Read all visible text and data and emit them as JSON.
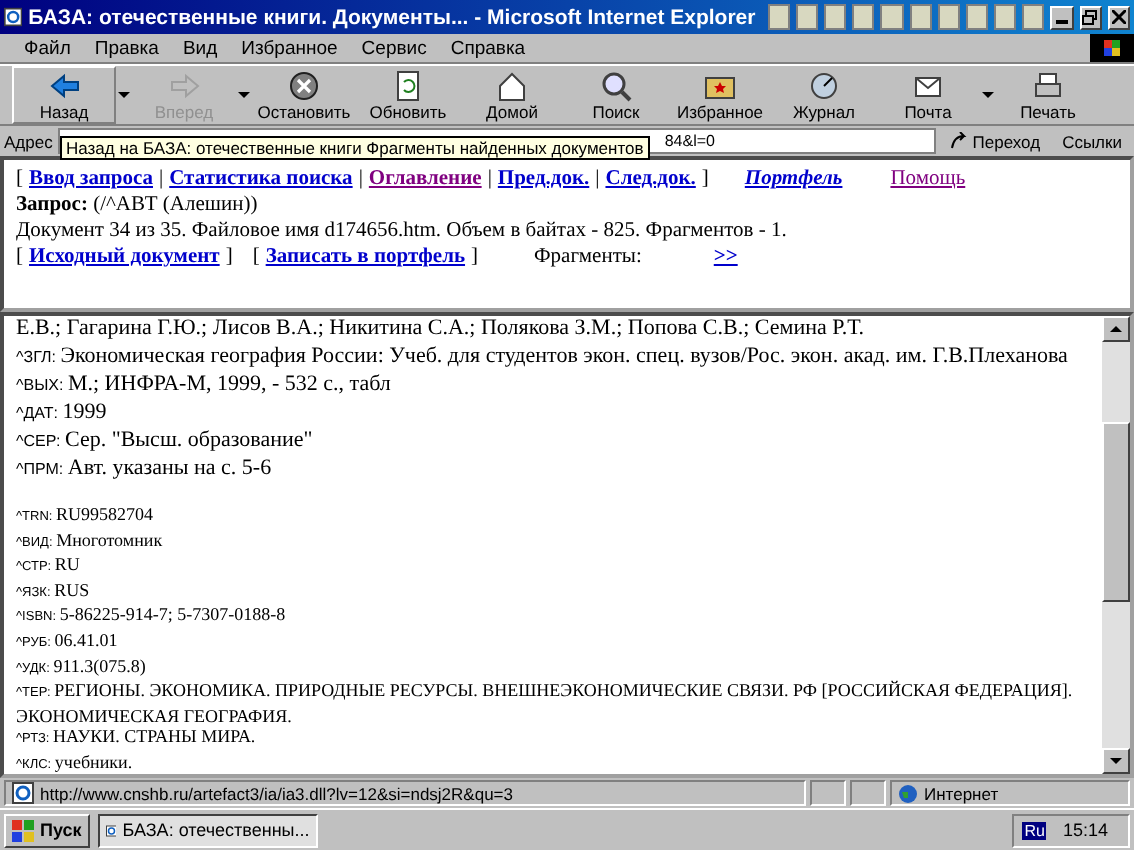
{
  "window": {
    "title": "БАЗА: отечественные книги. Документы... - Microsoft Internet Explorer"
  },
  "menu": [
    "Файл",
    "Правка",
    "Вид",
    "Избранное",
    "Сервис",
    "Справка"
  ],
  "toolbar": [
    {
      "label": "Назад",
      "kind": "back",
      "disabled": false,
      "dropdown": true
    },
    {
      "label": "Вперед",
      "kind": "forward",
      "disabled": true,
      "dropdown": true
    },
    {
      "label": "Остановить",
      "kind": "stop",
      "disabled": false,
      "dropdown": false
    },
    {
      "label": "Обновить",
      "kind": "refresh",
      "disabled": false,
      "dropdown": false
    },
    {
      "label": "Домой",
      "kind": "home",
      "disabled": false,
      "dropdown": false
    },
    {
      "label": "Поиск",
      "kind": "search",
      "disabled": false,
      "dropdown": false
    },
    {
      "label": "Избранное",
      "kind": "favorites",
      "disabled": false,
      "dropdown": false
    },
    {
      "label": "Журнал",
      "kind": "history",
      "disabled": false,
      "dropdown": false
    },
    {
      "label": "Почта",
      "kind": "mail",
      "disabled": false,
      "dropdown": true
    },
    {
      "label": "Печать",
      "kind": "print",
      "disabled": false,
      "dropdown": false
    }
  ],
  "address": {
    "label": "Адрес",
    "value": "84&l=0",
    "go": "Переход",
    "links": "Ссылки"
  },
  "tooltip": "Назад на БАЗА: отечественные книги Фрагменты найденных документов",
  "top_frame": {
    "open": "[",
    "close": "]",
    "separator": "|",
    "nav": [
      {
        "label": "Ввод запроса",
        "visited": false
      },
      {
        "label": "Статистика поиска",
        "visited": false
      },
      {
        "label": "Оглавление",
        "visited": true
      },
      {
        "label": "Пред.док.",
        "visited": false
      },
      {
        "label": "След.док.",
        "visited": false
      }
    ],
    "portfolio": {
      "label": "Портфель",
      "visited": false
    },
    "help": {
      "label": "Помощь",
      "visited": true
    },
    "query_label": "Запрос:",
    "query": "(/^АВТ (Алешин))",
    "info": "Документ 34 из 35. Файловое имя d174656.htm. Объем в байтах - 825. Фрагментов - 1.",
    "source_link": "Исходный документ",
    "save_link": "Записать в портфель",
    "fragments_label": "Фрагменты:",
    "next": ">>"
  },
  "records": [
    {
      "kind": "large",
      "value": "Е.В.; Гагарина Г.Ю.; Лисов В.А.; Никитина С.А.; Полякова З.М.; Попова С.В.; Семина Р.Т."
    },
    {
      "kind": "large",
      "tag": "^ЗГЛ:",
      "value": "Экономическая география России: Учеб. для студентов экон. спец. вузов/Рос. экон. акад. им. Г.В.Плеханова"
    },
    {
      "kind": "large",
      "tag": "^ВЫХ:",
      "value": "М.; ИНФРА-М, 1999, - 532 с., табл"
    },
    {
      "kind": "large",
      "tag": "^ДАТ:",
      "value": "1999"
    },
    {
      "kind": "large",
      "tag": "^СЕР:",
      "value": "Сер. \"Высш. образование\""
    },
    {
      "kind": "large",
      "tag": "^ПРМ:",
      "value": "Авт. указаны на с. 5-6"
    },
    {
      "kind": "small",
      "tag": "^TRN:",
      "value": "RU99582704"
    },
    {
      "kind": "small",
      "tag": "^ВИД:",
      "value": "Многотомник"
    },
    {
      "kind": "small",
      "tag": "^СТР:",
      "value": "RU"
    },
    {
      "kind": "small",
      "tag": "^ЯЗК:",
      "value": "RUS"
    },
    {
      "kind": "small",
      "tag": "^ISBN:",
      "value": "5-86225-914-7; 5-7307-0188-8"
    },
    {
      "kind": "small",
      "tag": "^РУБ:",
      "value": "06.41.01"
    },
    {
      "kind": "small",
      "tag": "^УДК:",
      "value": "911.3(075.8)"
    },
    {
      "kind": "small",
      "tag": "^ТЕР:",
      "value": "РЕГИОНЫ. ЭКОНОМИКА. ПРИРОДНЫЕ РЕСУРСЫ. ВНЕШНЕЭКОНОМИЧЕСКИЕ СВЯЗИ. РФ [РОССИЙСКАЯ ФЕДЕРАЦИЯ]. ЭКОНОМИЧЕСКАЯ ГЕОГРАФИЯ."
    },
    {
      "kind": "small",
      "tag": "^РТЗ:",
      "value": "НАУКИ. СТРАНЫ МИРА."
    },
    {
      "kind": "small",
      "tag": "^КЛС:",
      "value": "учебники."
    }
  ],
  "status_bar": {
    "url": "http://www.cnshb.ru/artefact3/ia/ia3.dll?lv=12&si=ndsj2R&qu=3",
    "zone": "Интернет"
  },
  "taskbar": {
    "start": "Пуск",
    "task": "БАЗА: отечественны...",
    "lang": "Ru",
    "clock": "15:14"
  }
}
